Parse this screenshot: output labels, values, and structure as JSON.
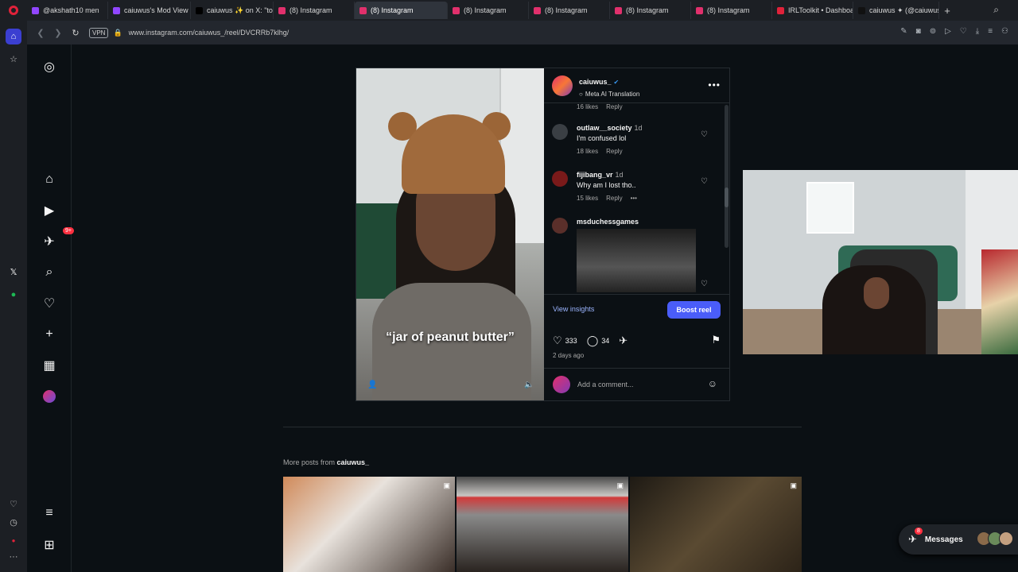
{
  "browser": {
    "tabs": [
      {
        "label": "@akshath10 men",
        "color": "#9146ff",
        "active": false
      },
      {
        "label": "caiuwus's Mod View",
        "color": "#9146ff",
        "active": false
      },
      {
        "label": "caiuwus ✨ on X: \"tod",
        "color": "#000000",
        "active": false
      },
      {
        "label": "(8) Instagram",
        "color": "#e1306c",
        "active": false
      },
      {
        "label": "(8) Instagram",
        "color": "#e1306c",
        "active": true
      },
      {
        "label": "(8) Instagram",
        "color": "#e1306c",
        "active": false
      },
      {
        "label": "(8) Instagram",
        "color": "#e1306c",
        "active": false
      },
      {
        "label": "(8) Instagram",
        "color": "#e1306c",
        "active": false
      },
      {
        "label": "(8) Instagram",
        "color": "#e1306c",
        "active": false
      },
      {
        "label": "IRLToolkit • Dashboar",
        "color": "#e0223a",
        "active": false
      },
      {
        "label": "caiuwus ✦ (@caiuwus",
        "color": "#111111",
        "active": false
      }
    ],
    "new_tab": "+",
    "vpn_label": "VPN",
    "url": "www.instagram.com/caiuwus_/reel/DVCRRb7klhg/"
  },
  "ig_nav": {
    "notifications_badge": "9+"
  },
  "post": {
    "caption": "“jar of peanut butter”",
    "author": "caiuwus_",
    "translation_label": "Meta AI Translation",
    "top_meta": {
      "likes": "16 likes",
      "reply": "Reply"
    },
    "comments": [
      {
        "user": "outlaw__society",
        "time": "1d",
        "text": "I'm confused lol",
        "likes": "18 likes",
        "reply": "Reply"
      },
      {
        "user": "fijibang_vr",
        "time": "1d",
        "text": "Why am I lost tho..",
        "likes": "15 likes",
        "reply": "Reply",
        "more": "•••"
      },
      {
        "user": "msduchessgames",
        "time": "",
        "text": "",
        "likes": "",
        "reply": ""
      }
    ],
    "view_insights": "View insights",
    "boost": "Boost reel",
    "likes_count": "333",
    "comments_count": "34",
    "posted_ago": "2 days ago",
    "comment_placeholder": "Add a comment..."
  },
  "more_posts": {
    "prefix": "More posts from ",
    "user": "caiuwus_"
  },
  "messages": {
    "label": "Messages",
    "badge": "8"
  },
  "colors": {
    "accent": "#4a5df9",
    "badge": "#ff3040",
    "bg": "#0b1014"
  }
}
